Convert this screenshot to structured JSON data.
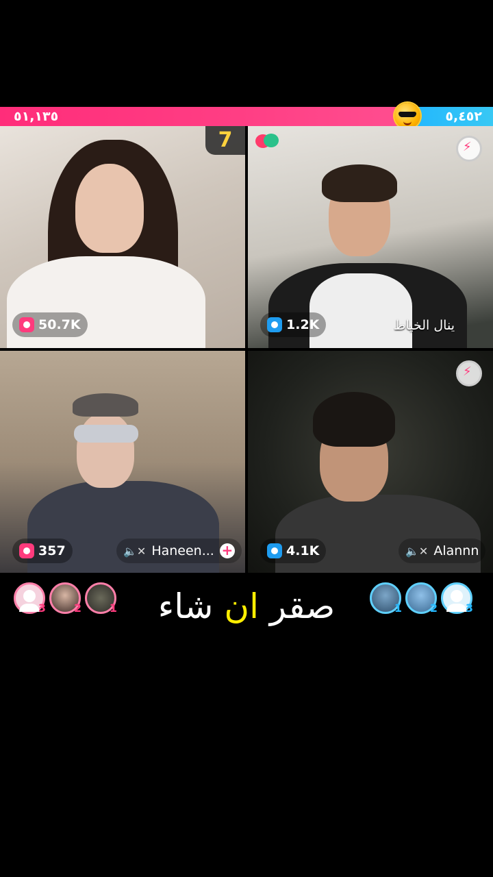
{
  "battle": {
    "score_left": "٥١,١٣٥",
    "score_right": "٥,٤٥٢",
    "round_number": "7",
    "colors": {
      "left": "#ff2d7a",
      "right": "#1fb4ff"
    }
  },
  "tiles": [
    {
      "gifts": "50.7K",
      "gift_icon": "gift-icon",
      "name": "",
      "muted": false
    },
    {
      "gifts": "1.2K",
      "gift_icon": "gift-icon",
      "name": "ينال الخياط",
      "muted": false
    },
    {
      "gifts": "357",
      "gift_icon": "gift-icon",
      "name": "Haneen...",
      "muted": true
    },
    {
      "gifts": "4.1K",
      "gift_icon": "gift-icon",
      "name": "Alannn",
      "muted": true
    }
  ],
  "caption": {
    "part1": "صقر ",
    "highlight": "ان",
    "part2": " شاء"
  },
  "ranks": {
    "left": [
      "3",
      "2",
      "1"
    ],
    "right": [
      "1",
      "2",
      "3"
    ]
  }
}
